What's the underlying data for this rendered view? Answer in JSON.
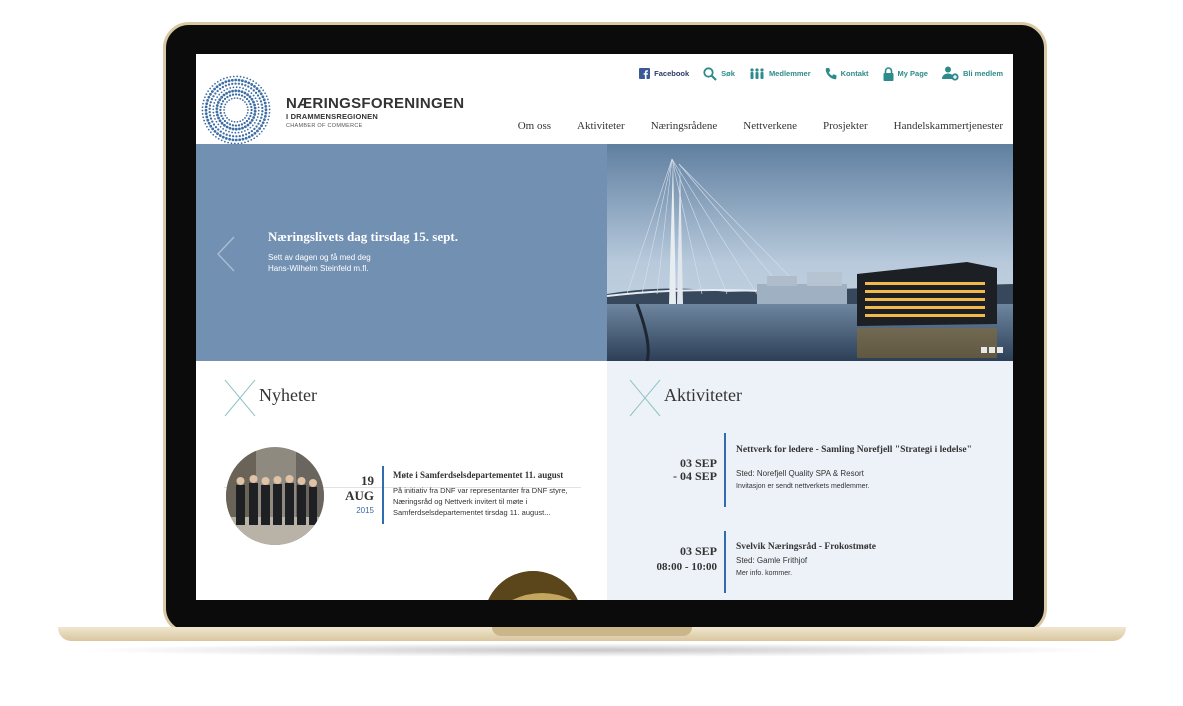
{
  "brand": {
    "name": "NÆRINGSFORENINGEN",
    "sub": "I DRAMMENSREGIONEN",
    "tagline": "CHAMBER OF COMMERCE"
  },
  "utility": [
    {
      "label": "Facebook",
      "icon": "facebook-icon"
    },
    {
      "label": "Søk",
      "icon": "search-icon"
    },
    {
      "label": "Medlemmer",
      "icon": "members-icon"
    },
    {
      "label": "Kontakt",
      "icon": "phone-icon"
    },
    {
      "label": "My Page",
      "icon": "lock-icon"
    },
    {
      "label": "Bli medlem",
      "icon": "add-user-icon"
    }
  ],
  "nav": [
    "Om oss",
    "Aktiviteter",
    "Næringsrådene",
    "Nettverkene",
    "Prosjekter",
    "Handelskammertjenester"
  ],
  "hero": {
    "title": "Næringslivets dag tirsdag 15. sept.",
    "line1": "Sett av dagen og få med deg",
    "line2": "Hans-Wilhelm Steinfeld m.fl."
  },
  "news": {
    "heading": "Nyheter",
    "items": [
      {
        "day": "19",
        "month": "AUG",
        "year": "2015",
        "title": "Møte i Samferdselsdepartementet 11. august",
        "text": "På initiativ fra DNF var representanter fra DNF styre, Næringsråd og Nettverk invitert til møte i Samferdselsdepartementet tirsdag 11. august..."
      }
    ]
  },
  "activities": {
    "heading": "Aktiviteter",
    "items": [
      {
        "date1": "03 SEP",
        "date2": "- 04 SEP",
        "title": "Nettverk for ledere - Samling Norefjell \"Strategi i ledelse\"",
        "place": "Sted: Norefjell Quality SPA & Resort",
        "note": "Invitasjon er sendt nettverkets medlemmer."
      },
      {
        "date1": "03 SEP",
        "date2": "08:00 - 10:00",
        "title": "Svelvik Næringsråd - Frokostmøte",
        "place": "Sted: Gamle Frithjof",
        "note": "Mer info. kommer."
      }
    ]
  },
  "colors": {
    "hero_blue": "#7290b2",
    "accent_teal": "#2d8b8b",
    "date_blue": "#2f6db0",
    "activities_bg": "#edf2f8"
  }
}
